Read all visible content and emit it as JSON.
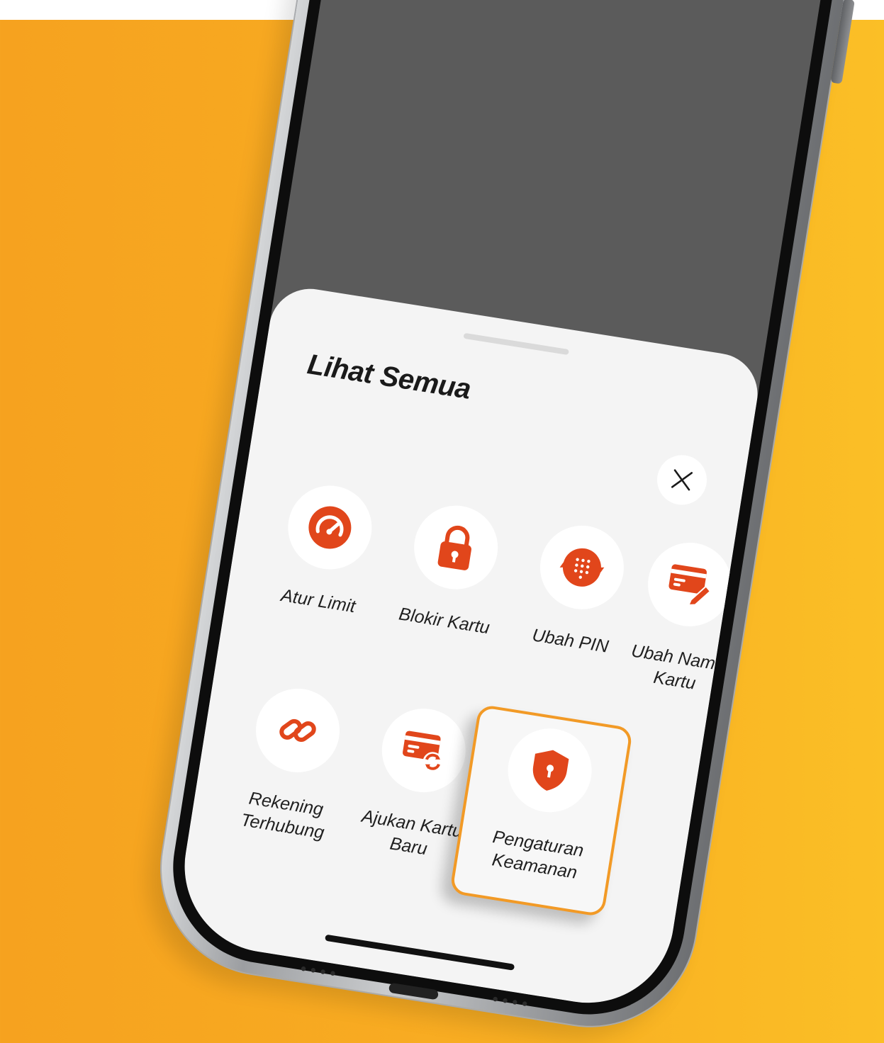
{
  "sheet": {
    "title": "Lihat Semua",
    "close_icon": "close-icon"
  },
  "colors": {
    "background": "#f7a520",
    "accent": "#e1461b",
    "highlight_border": "#f29a26",
    "sheet_background": "#f4f4f4",
    "screen_background": "#5b5b5b"
  },
  "menu": {
    "items": [
      {
        "label": "Atur Limit",
        "icon": "speedometer-icon"
      },
      {
        "label": "Blokir Kartu",
        "icon": "lock-icon"
      },
      {
        "label": "Ubah PIN",
        "icon": "pin-keypad-icon"
      },
      {
        "label": "Ubah Nama\nKartu",
        "icon": "card-edit-icon"
      },
      {
        "label": "Rekening\nTerhubung",
        "icon": "link-icon"
      },
      {
        "label": "Ajukan Kartu\nBaru",
        "icon": "card-refresh-icon"
      },
      {
        "label": "Pengaturan\nKeamanan",
        "icon": "shield-lock-icon",
        "highlighted": true
      }
    ]
  },
  "device": {
    "grill_left": "••••",
    "grill_right": "••••"
  }
}
